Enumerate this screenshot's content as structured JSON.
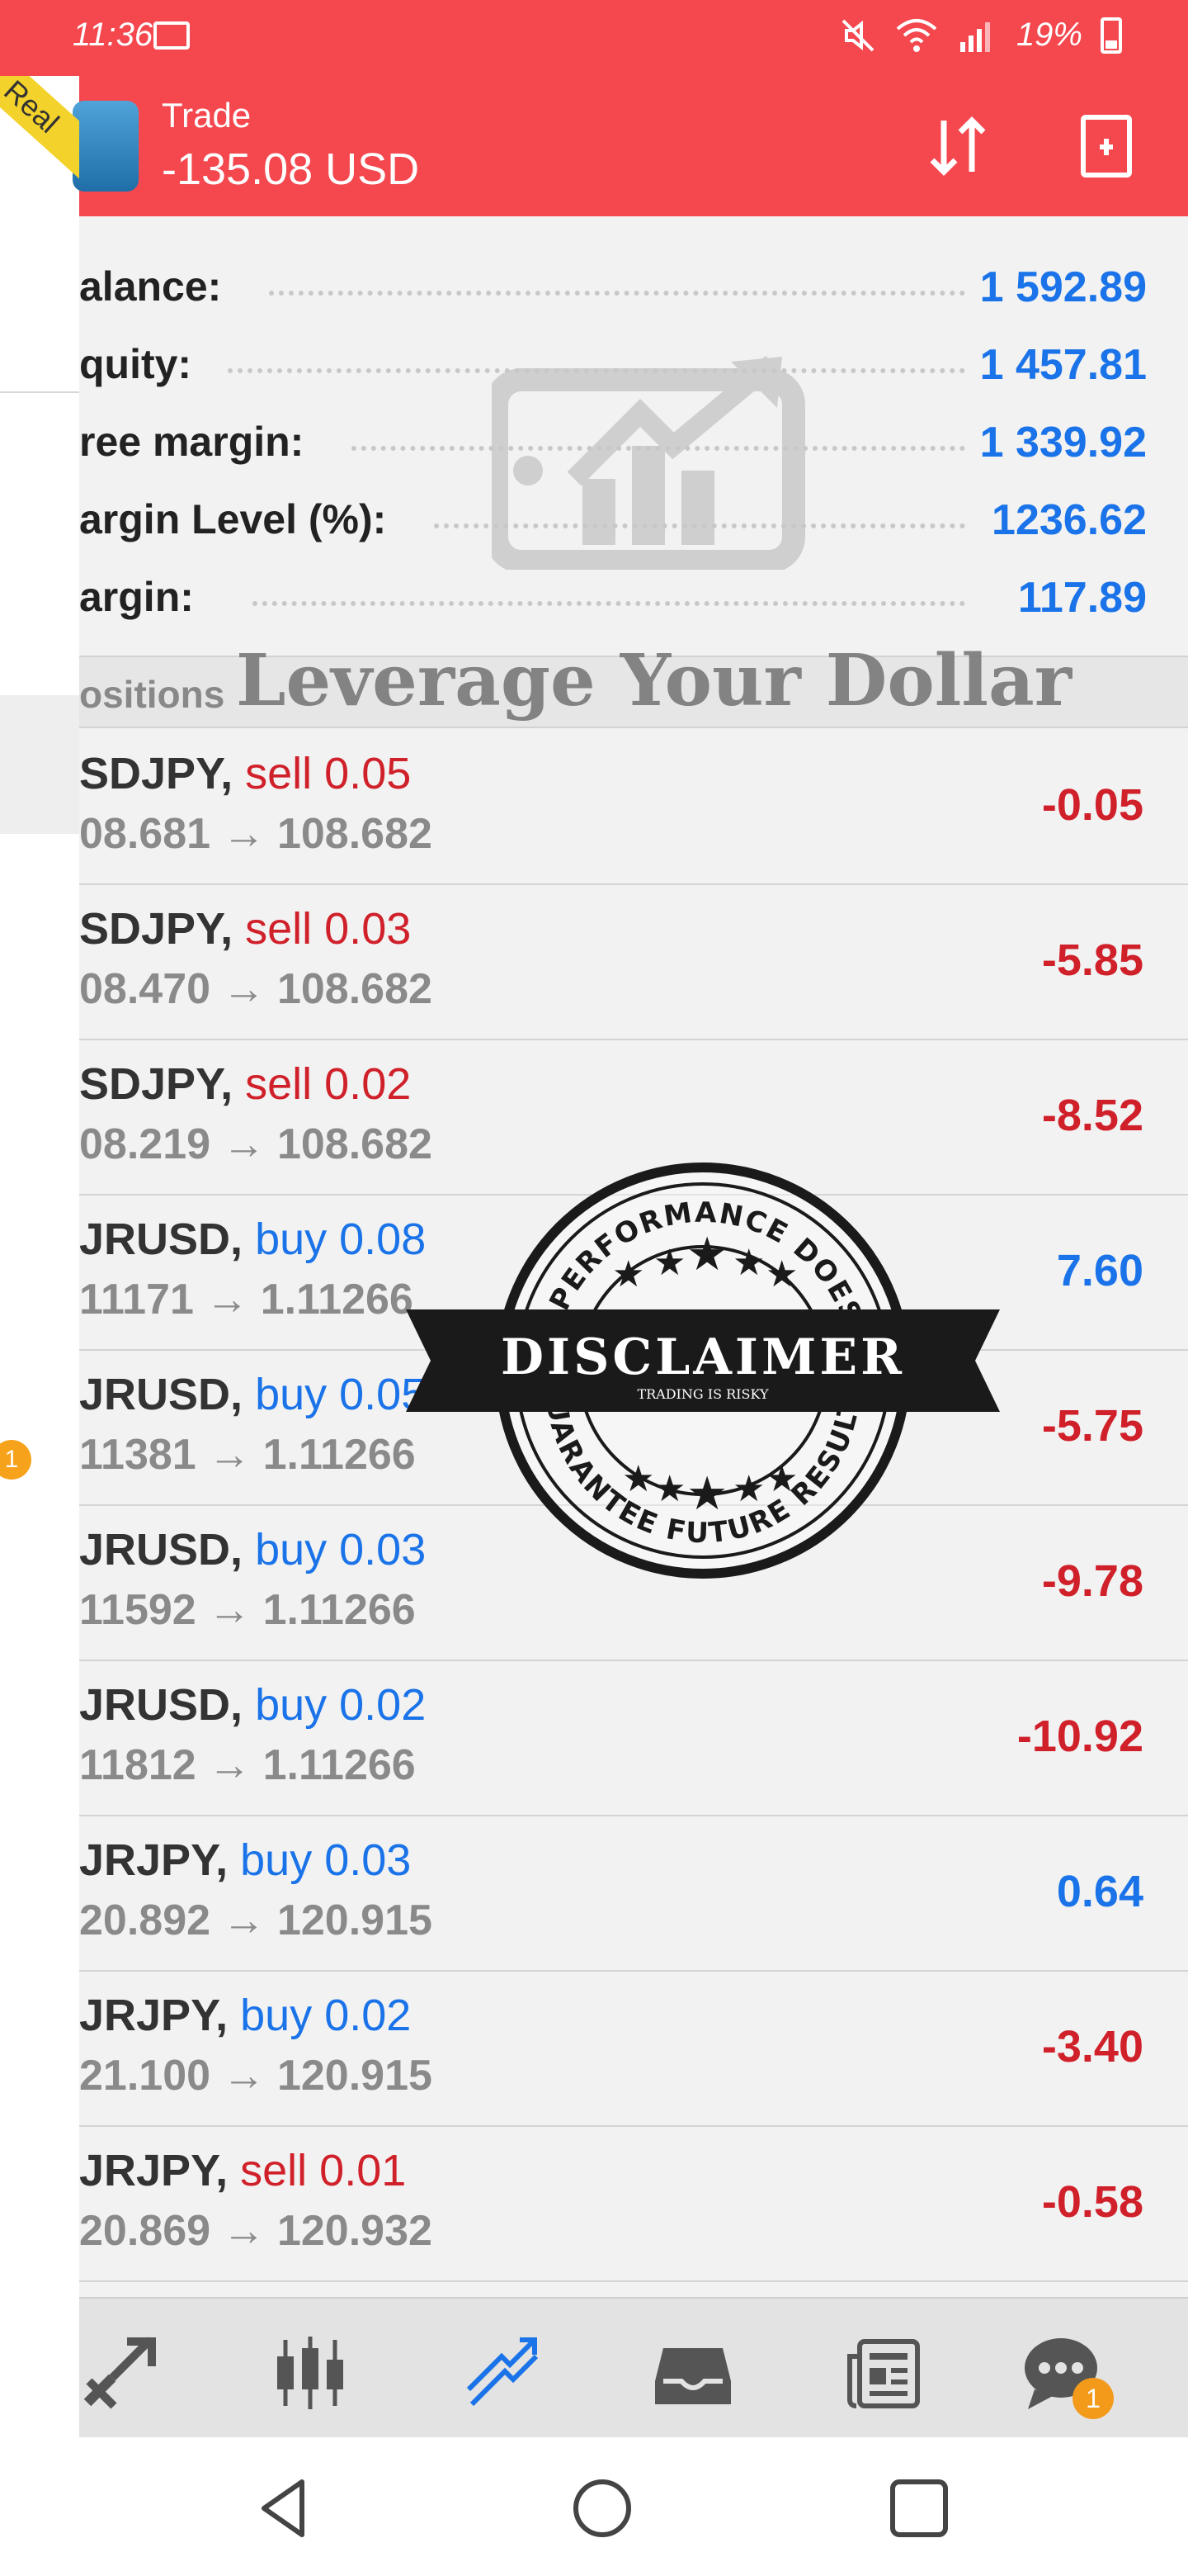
{
  "status_bar": {
    "time": "11:36",
    "battery": "19%"
  },
  "colors": {
    "accent_red": "#f4474e",
    "value_blue": "#1a73e8",
    "loss_red": "#d0202a",
    "badge_orange": "#f39a1b"
  },
  "app_bar": {
    "title": "Trade",
    "subtitle": "-135.08 USD",
    "account_ribbon": "Real",
    "icons": [
      "sort-icon",
      "add-document-icon"
    ]
  },
  "summary": [
    {
      "label": "alance:",
      "value": "1 592.89"
    },
    {
      "label": "quity:",
      "value": "1 457.81"
    },
    {
      "label": "ree margin:",
      "value": "1 339.92"
    },
    {
      "label": "argin Level (%):",
      "value": "1236.62"
    },
    {
      "label": "argin:",
      "value": "117.89"
    }
  ],
  "positions_header": "ositions",
  "watermark": {
    "banner": "Leverage Your Dollar"
  },
  "stamp": {
    "top_arc": "PAST PERFORMANCE DOES NOT",
    "title": "DISCLAIMER",
    "subtitle": "TRADING IS RISKY",
    "bottom_arc": "GUARANTEE FUTURE RESULTS"
  },
  "positions": [
    {
      "symbol": "SDJPY,",
      "side": "sell 0.05",
      "prices": "08.681 → 108.682",
      "profit": "-0.05",
      "direction": "sell",
      "profit_sign": "neg"
    },
    {
      "symbol": "SDJPY,",
      "side": "sell 0.03",
      "prices": "08.470 → 108.682",
      "profit": "-5.85",
      "direction": "sell",
      "profit_sign": "neg"
    },
    {
      "symbol": "SDJPY,",
      "side": "sell 0.02",
      "prices": "08.219 → 108.682",
      "profit": "-8.52",
      "direction": "sell",
      "profit_sign": "neg"
    },
    {
      "symbol": "JRUSD,",
      "side": "buy 0.08",
      "prices": "11171 → 1.11266",
      "profit": "7.60",
      "direction": "buy",
      "profit_sign": "pos"
    },
    {
      "symbol": "JRUSD,",
      "side": "buy 0.05",
      "prices": "11381 → 1.11266",
      "profit": "-5.75",
      "direction": "buy",
      "profit_sign": "neg"
    },
    {
      "symbol": "JRUSD,",
      "side": "buy 0.03",
      "prices": "11592 → 1.11266",
      "profit": "-9.78",
      "direction": "buy",
      "profit_sign": "neg"
    },
    {
      "symbol": "JRUSD,",
      "side": "buy 0.02",
      "prices": "11812 → 1.11266",
      "profit": "-10.92",
      "direction": "buy",
      "profit_sign": "neg"
    },
    {
      "symbol": "JRJPY,",
      "side": "buy 0.03",
      "prices": "20.892 → 120.915",
      "profit": "0.64",
      "direction": "buy",
      "profit_sign": "pos"
    },
    {
      "symbol": "JRJPY,",
      "side": "buy 0.02",
      "prices": "21.100 → 120.915",
      "profit": "-3.40",
      "direction": "buy",
      "profit_sign": "neg"
    },
    {
      "symbol": "JRJPY,",
      "side": "sell 0.01",
      "prices": "20.869 → 120.932",
      "profit": "-0.58",
      "direction": "sell",
      "profit_sign": "neg"
    }
  ],
  "bottom_nav": {
    "items": [
      "quotes-icon",
      "chart-icon",
      "trade-icon",
      "history-icon",
      "news-icon",
      "messages-icon"
    ],
    "active": "trade-icon",
    "messages_badge": "1"
  },
  "drawer": {
    "badge": "1"
  },
  "system_nav": [
    "back-icon",
    "home-icon",
    "recents-icon"
  ]
}
